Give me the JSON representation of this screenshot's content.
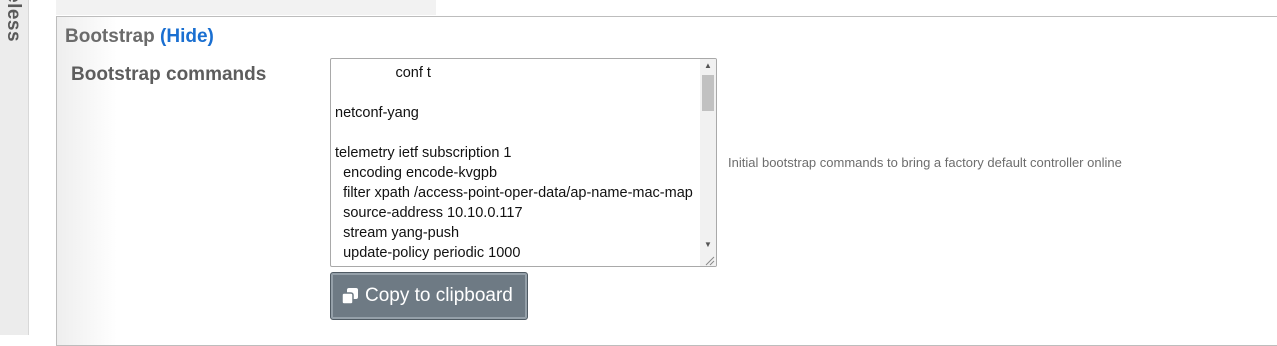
{
  "left_rail": {
    "text": "eless"
  },
  "section": {
    "title": "Bootstrap",
    "toggle_label": "(Hide)"
  },
  "field": {
    "label": "Bootstrap commands",
    "textarea_value": "               conf t\n\nnetconf-yang\n\ntelemetry ietf subscription 1\n  encoding encode-kvgpb\n  filter xpath /access-point-oper-data/ap-name-mac-map\n  source-address 10.10.0.117\n  stream yang-push\n  update-policy periodic 1000",
    "help_text": "Initial bootstrap commands to bring a factory default controller online"
  },
  "copy_button": {
    "label": "Copy to clipboard",
    "icon": "copy-icon"
  }
}
